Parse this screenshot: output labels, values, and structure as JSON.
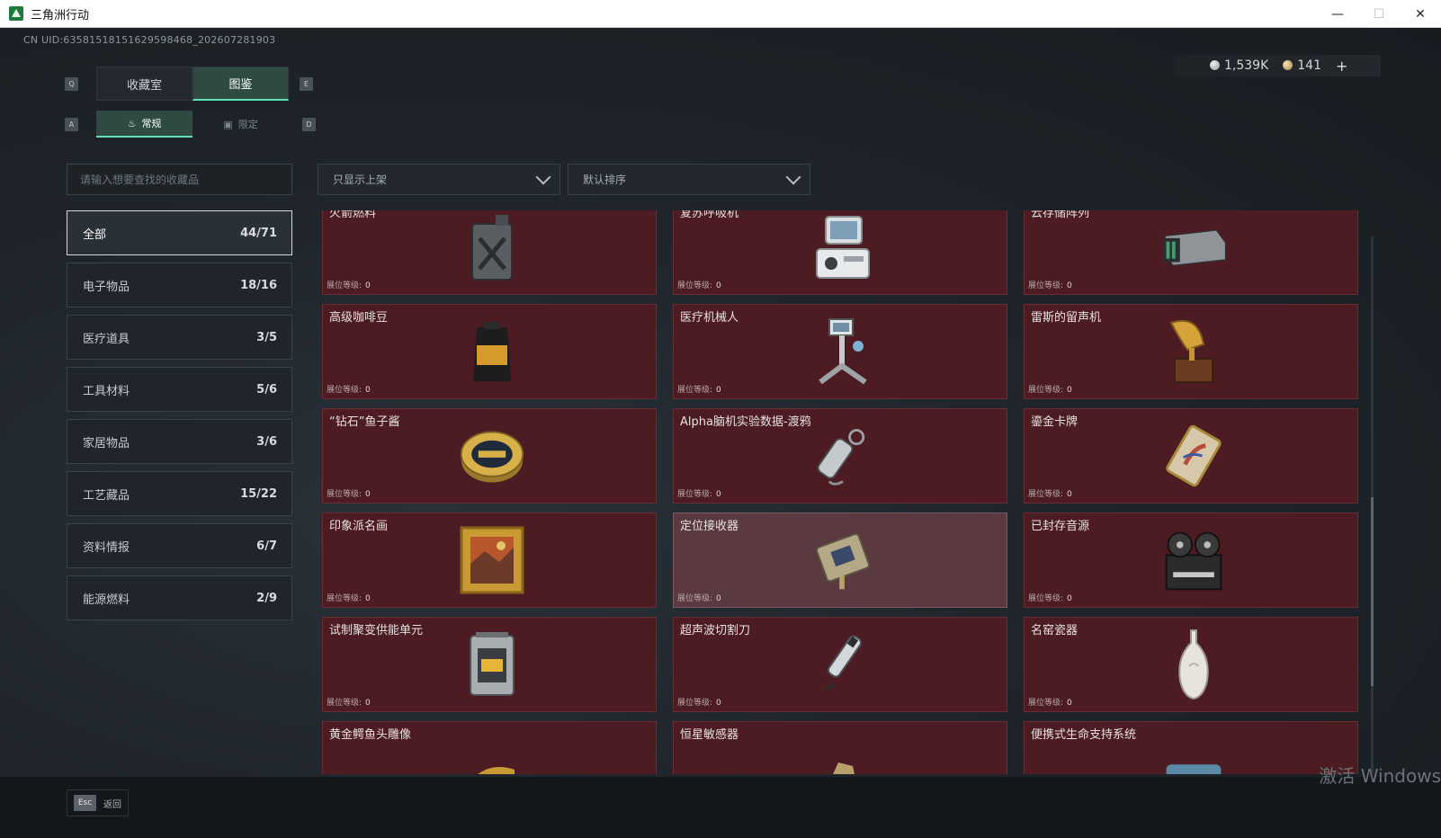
{
  "window": {
    "title": "三角洲行动",
    "minimize": "—",
    "maximize": "☐",
    "close": "✕"
  },
  "uid": "CN UID:63581518151629598468_202607281903",
  "currency": {
    "silver": "1,539K",
    "gold": "141",
    "add": "+"
  },
  "keys": {
    "q": "Q",
    "e": "E",
    "a": "A",
    "d": "D",
    "esc": "Esc"
  },
  "tabs": [
    {
      "label": "收藏室"
    },
    {
      "label": "图鉴"
    }
  ],
  "subtabs": [
    {
      "label": "常规",
      "icon": "flame-icon"
    },
    {
      "label": "限定",
      "icon": "frame-icon"
    }
  ],
  "search": {
    "placeholder": "请输入想要查找的收藏品"
  },
  "filters": {
    "shelf": "只显示上架",
    "sort": "默认排序"
  },
  "categories": [
    {
      "label": "全部",
      "count": "44/71"
    },
    {
      "label": "电子物品",
      "count": "18/16"
    },
    {
      "label": "医疗道具",
      "count": "3/5"
    },
    {
      "label": "工具材料",
      "count": "5/6"
    },
    {
      "label": "家居物品",
      "count": "3/6"
    },
    {
      "label": "工艺藏品",
      "count": "15/22"
    },
    {
      "label": "资料情报",
      "count": "6/7"
    },
    {
      "label": "能源燃料",
      "count": "2/9"
    }
  ],
  "level_label": "展位等级:",
  "items": [
    {
      "name": "火箭燃料",
      "level": "0",
      "icon": "fuel-can-icon"
    },
    {
      "name": "复苏呼吸机",
      "level": "0",
      "icon": "ventilator-icon"
    },
    {
      "name": "云存储阵列",
      "level": "0",
      "icon": "storage-array-icon"
    },
    {
      "name": "高级咖啡豆",
      "level": "0",
      "icon": "coffee-bag-icon"
    },
    {
      "name": "医疗机械人",
      "level": "0",
      "icon": "medical-robot-icon"
    },
    {
      "name": "雷斯的留声机",
      "level": "0",
      "icon": "gramophone-icon"
    },
    {
      "name": "“钻石”鱼子酱",
      "level": "0",
      "icon": "caviar-tin-icon"
    },
    {
      "name": "Alpha脑机实验数据-渡鸦",
      "level": "0",
      "icon": "data-drive-icon"
    },
    {
      "name": "鎏金卡牌",
      "level": "0",
      "icon": "gold-card-icon"
    },
    {
      "name": "印象派名画",
      "level": "0",
      "icon": "painting-icon"
    },
    {
      "name": "定位接收器",
      "level": "0",
      "icon": "gps-receiver-icon"
    },
    {
      "name": "已封存音源",
      "level": "0",
      "icon": "reel-recorder-icon"
    },
    {
      "name": "试制聚变供能单元",
      "level": "0",
      "icon": "fusion-cell-icon"
    },
    {
      "name": "超声波切割刀",
      "level": "0",
      "icon": "ultrasonic-knife-icon"
    },
    {
      "name": "名窑瓷器",
      "level": "0",
      "icon": "porcelain-vase-icon"
    },
    {
      "name": "黄金鳄鱼头雕像",
      "level": "",
      "icon": "crocodile-statue-icon"
    },
    {
      "name": "恒星敏感器",
      "level": "",
      "icon": "star-sensor-icon"
    },
    {
      "name": "便携式生命支持系统",
      "level": "",
      "icon": "life-support-icon"
    }
  ],
  "footer": {
    "back": "返回"
  },
  "watermark": "激活 Windows",
  "colors": {
    "accent": "#5fe0b0",
    "card_bg": "#4d1b22",
    "card_hover": "#5a3a40"
  }
}
